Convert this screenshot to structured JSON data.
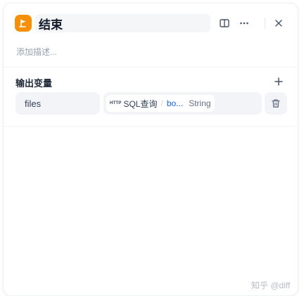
{
  "header": {
    "title": "结束",
    "node_icon": "end-node-icon",
    "accent_color": "#f79009"
  },
  "description": {
    "placeholder": "添加描述..."
  },
  "output_section": {
    "title": "输出变量",
    "variables": [
      {
        "name": "files",
        "source_badge": "HTTP",
        "source_node": "SQL查询",
        "source_var": "bo...",
        "type": "String"
      }
    ]
  },
  "watermark": "知乎 @diff"
}
